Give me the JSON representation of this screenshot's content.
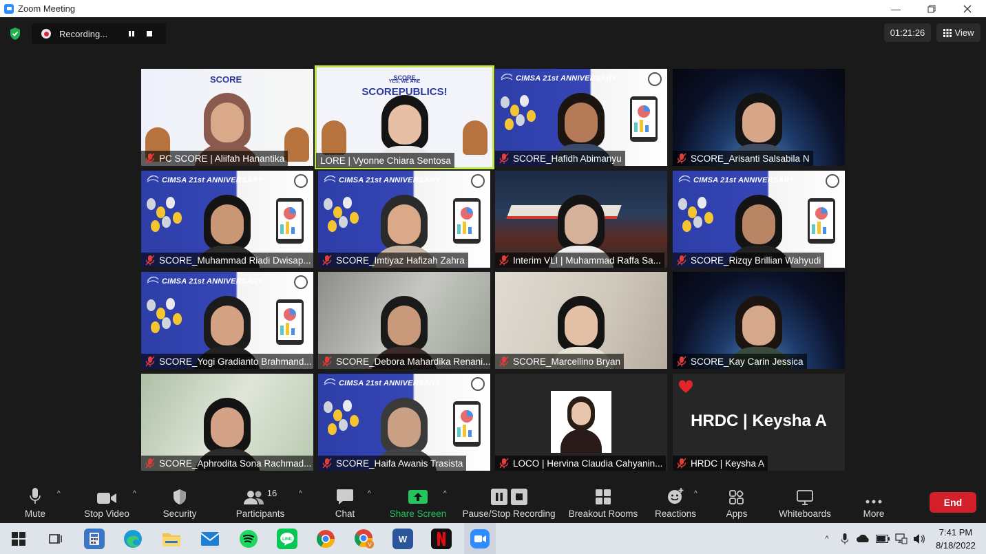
{
  "window": {
    "title": "Zoom Meeting"
  },
  "top": {
    "recording_label": "Recording...",
    "timer": "01:21:26",
    "view_label": "View"
  },
  "tiles": [
    {
      "name": "PC SCORE | Aliifah Hanantika",
      "muted": true
    },
    {
      "name": "LORE | Vyonne Chiara Sentosa",
      "muted": false,
      "active": true,
      "banner_small": "YES, WE ARE",
      "banner_big": "SCOREPUBLICS!"
    },
    {
      "name": "SCORE_Hafidh Abimanyu",
      "muted": true
    },
    {
      "name": "SCORE_Arisanti Salsabila N",
      "muted": true
    },
    {
      "name": "SCORE_Muhammad Riadi Dwisap...",
      "muted": true
    },
    {
      "name": "SCORE_Imtiyaz Hafizah Zahra",
      "muted": true
    },
    {
      "name": "Interim VLI | Muhammad Raffa Sa...",
      "muted": true
    },
    {
      "name": "SCORE_Rizqy Brillian Wahyudi",
      "muted": true
    },
    {
      "name": "SCORE_Yogi Gradianto Brahmand...",
      "muted": true
    },
    {
      "name": "SCORE_Debora Mahardika Renani...",
      "muted": true
    },
    {
      "name": "SCORE_Marcellino Bryan",
      "muted": true
    },
    {
      "name": "SCORE_Kay Carin Jessica",
      "muted": true
    },
    {
      "name": "SCORE_Aphrodita Sona Rachmad...",
      "muted": true
    },
    {
      "name": "SCORE_Haifa Awanis Trasista",
      "muted": true
    },
    {
      "name": "LOCO | Hervina Claudia Cahyanin...",
      "muted": true
    },
    {
      "name": "HRDC | Keysha A",
      "muted": true,
      "display_name": "HRDC | Keysha A"
    }
  ],
  "banner_text": "CIMSA 21st ANNIVERSARY",
  "score_logo_text": "SCORE",
  "toolbar": {
    "mute": "Mute",
    "stop_video": "Stop Video",
    "security": "Security",
    "participants": "Participants",
    "participants_count": "16",
    "chat": "Chat",
    "share_screen": "Share Screen",
    "pause_stop_recording": "Pause/Stop Recording",
    "breakout_rooms": "Breakout Rooms",
    "reactions": "Reactions",
    "apps": "Apps",
    "whiteboards": "Whiteboards",
    "more": "More",
    "end": "End"
  },
  "taskbar": {
    "time": "7:41 PM",
    "date": "8/18/2022"
  },
  "colors": {
    "accent_green": "#22c55e",
    "end_red": "#d21f2b",
    "active_speaker": "#c3e84a",
    "zoom_blue": "#2d8cff"
  }
}
